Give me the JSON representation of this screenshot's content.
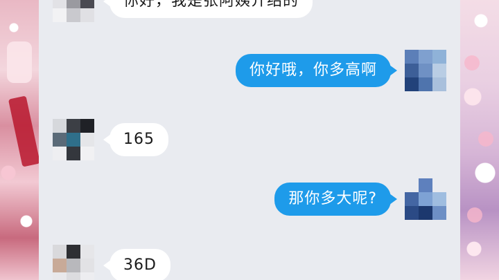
{
  "theme": {
    "incoming_bubble": "#ffffff",
    "outgoing_bubble": "#1e9bea",
    "chat_background": "#e9ebf0"
  },
  "messages": [
    {
      "direction": "in",
      "text": "你好，我是张阿姨介绍的",
      "avatar_icon": "pixelated-avatar-icon"
    },
    {
      "direction": "out",
      "text": "你好哦，你多高啊",
      "avatar_icon": "pixelated-avatar-icon"
    },
    {
      "direction": "in",
      "text": "165",
      "avatar_icon": "pixelated-avatar-icon"
    },
    {
      "direction": "out",
      "text": "那你多大呢?",
      "avatar_icon": "pixelated-avatar-icon"
    },
    {
      "direction": "in",
      "text": "36D",
      "avatar_icon": "pixelated-avatar-icon"
    }
  ]
}
